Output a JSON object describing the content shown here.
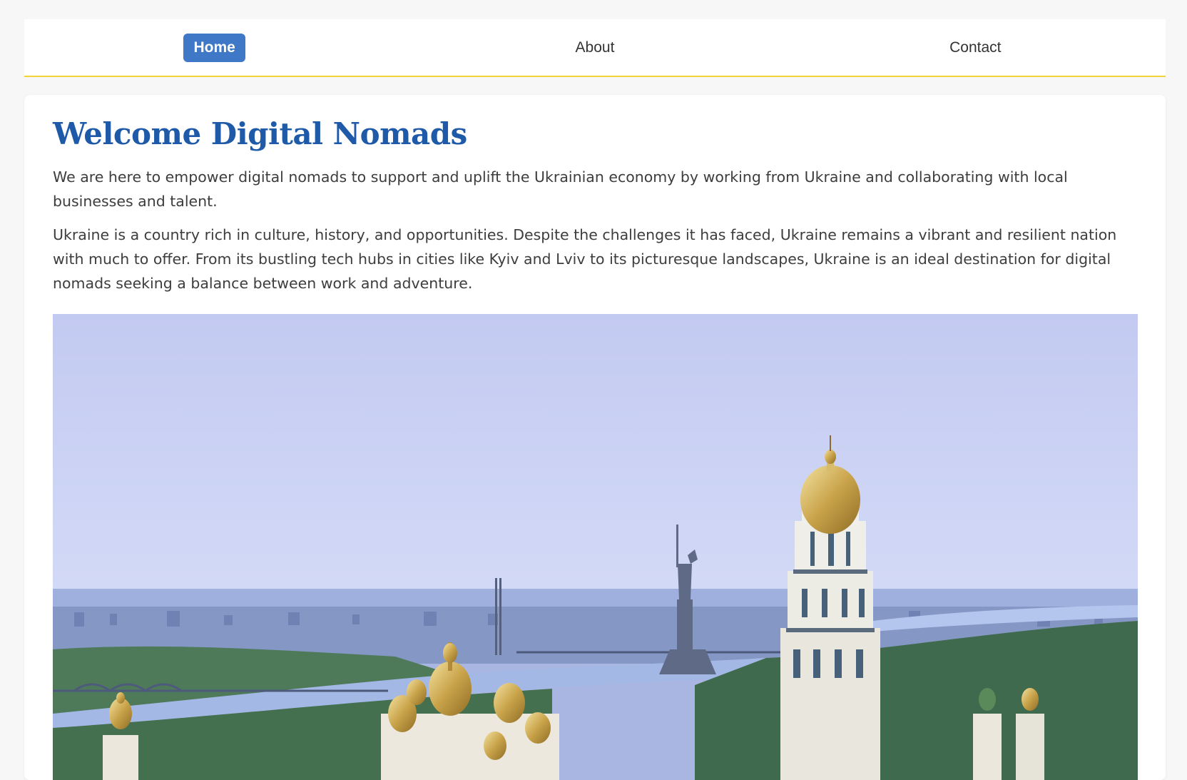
{
  "nav": {
    "items": [
      {
        "label": "Home",
        "active": true
      },
      {
        "label": "About",
        "active": false
      },
      {
        "label": "Contact",
        "active": false
      }
    ],
    "accent_color": "#3f78c6",
    "border_color": "#f2d33a"
  },
  "main": {
    "title": "Welcome Digital Nomads",
    "title_color": "#1f5aa8",
    "paragraphs": [
      "We are here to empower digital nomads to support and uplift the Ukrainian economy by working from Ukraine and collaborating with local businesses and talent.",
      "Ukraine is a country rich in culture, history, and opportunities. Despite the challenges it has faced, Ukraine remains a vibrant and resilient nation with much to offer. From its bustling tech hubs in cities like Kyiv and Lviv to its picturesque landscapes, Ukraine is an ideal destination for digital nomads seeking a balance between work and adventure."
    ]
  }
}
